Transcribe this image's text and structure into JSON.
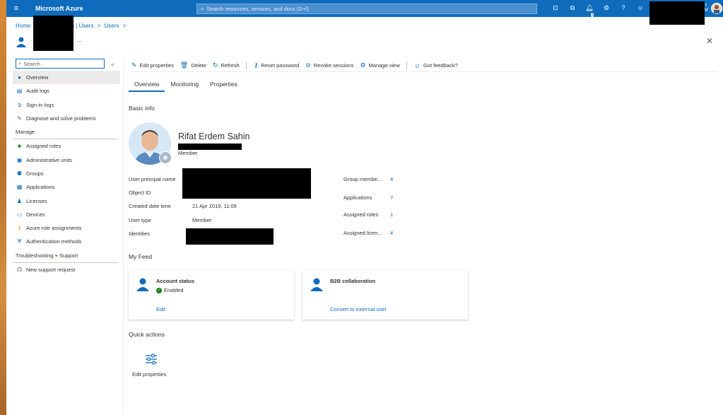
{
  "topbar": {
    "brand": "Microsoft Azure",
    "search_placeholder": "Search resources, services, and docs (G+/)",
    "notif_count": "1",
    "user_initials": "n",
    "user_sub": "M"
  },
  "breadcrumb": [
    "Home",
    "n | Users",
    ">",
    "Users",
    ">"
  ],
  "page": {
    "ellipsis": "..."
  },
  "nav": {
    "search_placeholder": "Search",
    "collapse": "«",
    "items_top": [
      {
        "label": "Overview",
        "icon": "user-icon"
      },
      {
        "label": "Audit logs",
        "icon": "document-icon"
      },
      {
        "label": "Sign-in logs",
        "icon": "signin-icon"
      },
      {
        "label": "Diagnose and solve problems",
        "icon": "wrench-icon"
      }
    ],
    "manage_heading": "Manage",
    "manage_items": [
      {
        "label": "Assigned roles",
        "icon": "roles-icon"
      },
      {
        "label": "Administrative units",
        "icon": "admin-units-icon"
      },
      {
        "label": "Groups",
        "icon": "groups-icon"
      },
      {
        "label": "Applications",
        "icon": "apps-icon"
      },
      {
        "label": "Licenses",
        "icon": "licenses-icon"
      },
      {
        "label": "Devices",
        "icon": "devices-icon"
      },
      {
        "label": "Azure role assignments",
        "icon": "key-icon"
      },
      {
        "label": "Authentication methods",
        "icon": "shield-icon"
      }
    ],
    "support_heading": "Troubleshooting + Support",
    "support_items": [
      {
        "label": "New support request",
        "icon": "support-icon"
      }
    ]
  },
  "toolbar": {
    "edit": "Edit properties",
    "delete": "Delete",
    "refresh": "Refresh",
    "reset": "Reset password",
    "revoke": "Revoke sessions",
    "manage_view": "Manage view",
    "feedback": "Got feedback?"
  },
  "tabs": [
    "Overview",
    "Monitoring",
    "Properties"
  ],
  "basic_info": {
    "heading": "Basic info",
    "name": "Rifat Erdem Sahin",
    "role": "Member",
    "fields": [
      {
        "label": "User principal name",
        "value": ""
      },
      {
        "label": "Object ID",
        "value": ""
      },
      {
        "label": "Created date time",
        "value": "21 Apr 2019, 11:09"
      },
      {
        "label": "User type",
        "value": "Member"
      },
      {
        "label": "Identities",
        "value": ""
      }
    ],
    "stats": [
      {
        "label": "Group membe...",
        "value": "4"
      },
      {
        "label": "Applications",
        "value": "7"
      },
      {
        "label": "Assigned roles",
        "value": "1"
      },
      {
        "label": "Assigned licen...",
        "value": "4"
      }
    ]
  },
  "feed": {
    "heading": "My Feed",
    "cards": [
      {
        "title": "Account status",
        "status": "Enabled",
        "link": "Edit"
      },
      {
        "title": "B2B collaboration",
        "status": "",
        "link": "Convert to external user"
      }
    ]
  },
  "quick_actions": {
    "heading": "Quick actions",
    "items": [
      {
        "label": "Edit properties"
      }
    ]
  },
  "colors": {
    "accent": "#0f6cbd",
    "topbar": "#0f6cbd",
    "success": "#107c10"
  }
}
